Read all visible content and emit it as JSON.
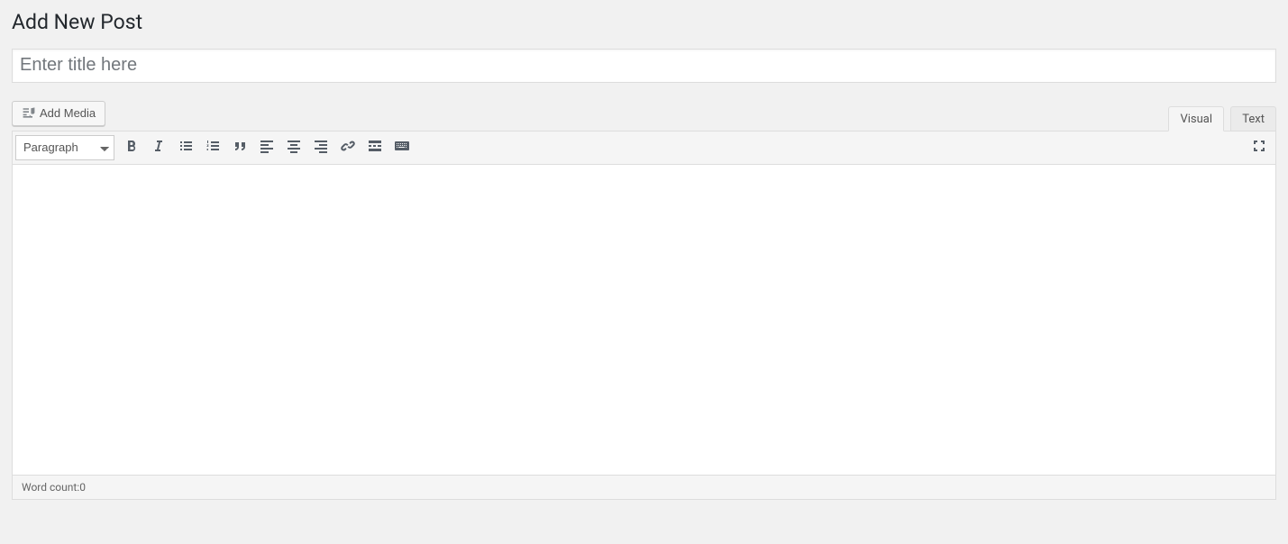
{
  "page_title": "Add New Post",
  "title_placeholder": "Enter title here",
  "title_value": "",
  "add_media_label": "Add Media",
  "tabs": {
    "visual": "Visual",
    "text": "Text"
  },
  "format_select": "Paragraph",
  "content_value": "",
  "status": {
    "word_count_label": "Word count: ",
    "word_count_value": "0"
  }
}
